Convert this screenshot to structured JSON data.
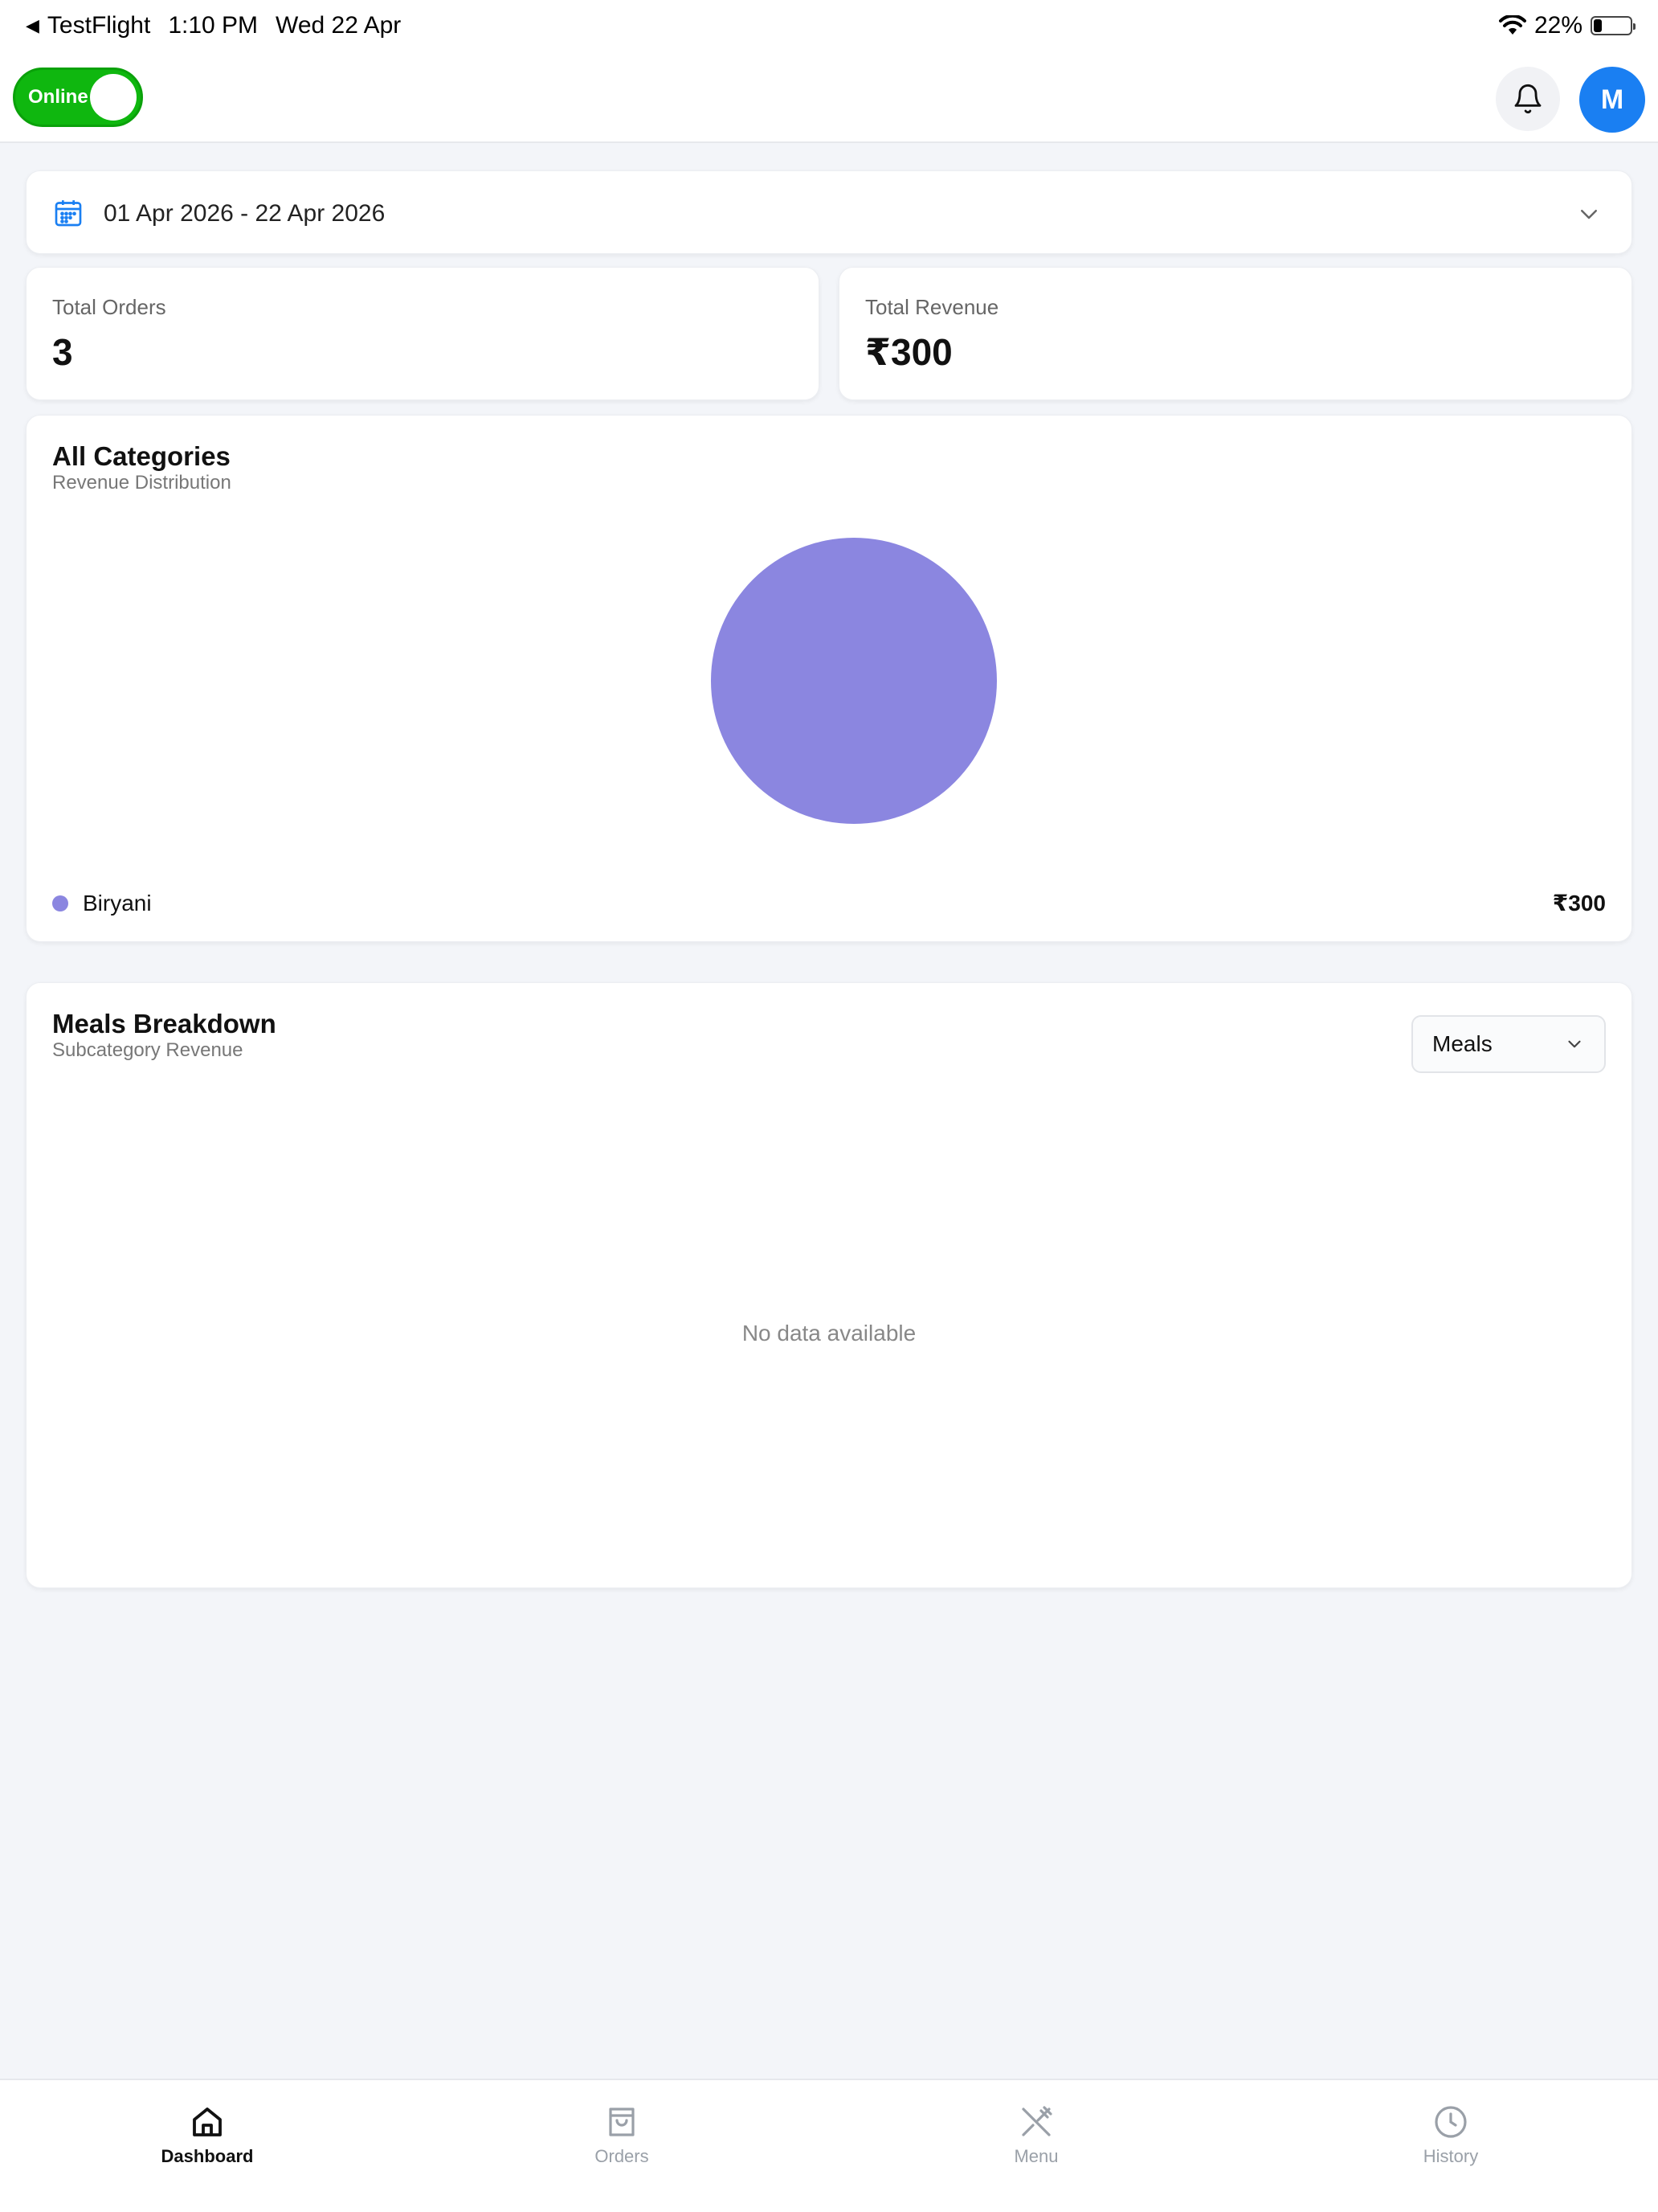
{
  "status_bar": {
    "back_app": "TestFlight",
    "time": "1:10 PM",
    "date": "Wed 22 Apr",
    "battery": "22%",
    "battery_level": 0.22
  },
  "header": {
    "online_toggle_label": "Online",
    "online": true,
    "avatar_initial": "M",
    "accent_color": "#1a7ff2",
    "toggle_color": "#0fb70f"
  },
  "date_filter": {
    "range": "01 Apr 2026 - 22 Apr 2026"
  },
  "stats": {
    "orders_label": "Total Orders",
    "orders_value": "3",
    "revenue_label": "Total Revenue",
    "revenue_value": "₹300"
  },
  "categories": {
    "title": "All Categories",
    "subtitle": "Revenue Distribution",
    "legend_label": "Biryani",
    "legend_value": "₹300",
    "legend_color": "#8b86e0"
  },
  "chart_data": {
    "type": "pie",
    "categories": [
      "Biryani"
    ],
    "values": [
      300
    ],
    "colors": [
      "#8b86e0"
    ],
    "legend_placement": "bottom"
  },
  "meals": {
    "title": "Meals Breakdown",
    "subtitle": "Subcategory Revenue",
    "selected": "Meals",
    "empty_message": "No data available"
  },
  "tabbar": {
    "tabs": [
      {
        "label": "Dashboard",
        "icon": "home-icon",
        "active": true
      },
      {
        "label": "Orders",
        "icon": "shopping-bag-icon",
        "active": false
      },
      {
        "label": "Menu",
        "icon": "utensils-icon",
        "active": false
      },
      {
        "label": "History",
        "icon": "clock-icon",
        "active": false
      }
    ]
  }
}
